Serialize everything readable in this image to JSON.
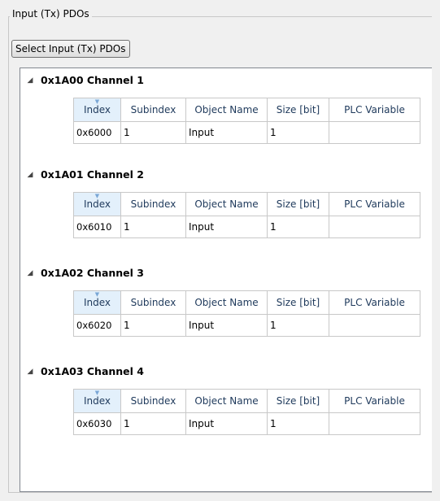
{
  "groupbox": {
    "title": "Input (Tx) PDOs",
    "select_button_label": "Select Input (Tx) PDOs"
  },
  "columns": [
    "Index",
    "Subindex",
    "Object Name",
    "Size [bit]",
    "PLC Variable"
  ],
  "nodes": [
    {
      "label": "0x1A00 Channel 1",
      "rows": [
        {
          "index": "0x6000",
          "subindex": "1",
          "object_name": "Input",
          "size": "1",
          "plc_variable": ""
        }
      ]
    },
    {
      "label": "0x1A01 Channel 2",
      "rows": [
        {
          "index": "0x6010",
          "subindex": "1",
          "object_name": "Input",
          "size": "1",
          "plc_variable": ""
        }
      ]
    },
    {
      "label": "0x1A02 Channel 3",
      "rows": [
        {
          "index": "0x6020",
          "subindex": "1",
          "object_name": "Input",
          "size": "1",
          "plc_variable": ""
        }
      ]
    },
    {
      "label": "0x1A03 Channel 4",
      "rows": [
        {
          "index": "0x6030",
          "subindex": "1",
          "object_name": "Input",
          "size": "1",
          "plc_variable": ""
        }
      ]
    }
  ],
  "icons": {
    "expander": "expanded-triangle-icon",
    "sort": "sort-indicator-icon"
  }
}
